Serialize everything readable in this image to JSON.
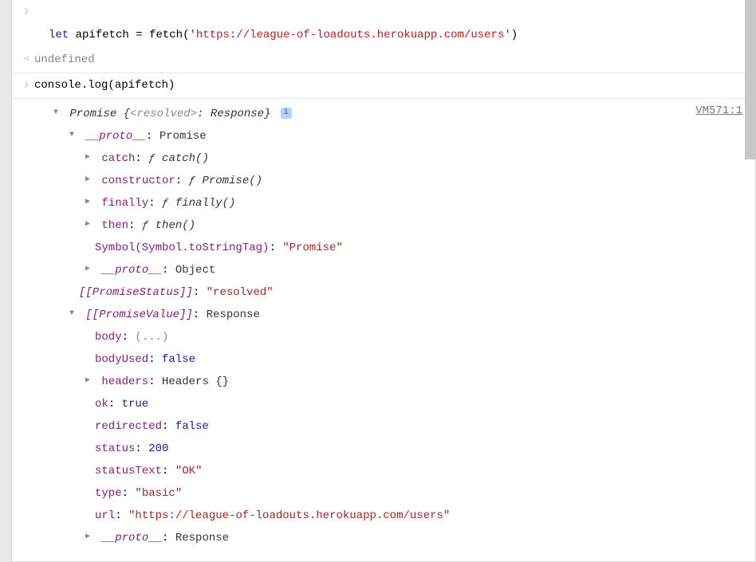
{
  "input1": {
    "indent_fill": "",
    "let": "let",
    "varname": "apifetch",
    "eq": " = ",
    "fn": "fetch(",
    "arg": "'https://league-of-loadouts.herokuapp.com/users'",
    "close": ")"
  },
  "return1": "undefined",
  "input2": "console.log(apifetch)",
  "log": {
    "source": "VM571:1",
    "header_pre": "Promise {",
    "header_status": "<resolved>",
    "header_colon": ": ",
    "header_val": "Response",
    "header_close": "}",
    "proto_label": "__proto__",
    "proto_val": "Promise",
    "catch_label": "catch",
    "catch_val_f": "ƒ ",
    "catch_val": "catch()",
    "constructor_label": "constructor",
    "constructor_val_f": "ƒ ",
    "constructor_val": "Promise()",
    "finally_label": "finally",
    "finally_val_f": "ƒ ",
    "finally_val": "finally()",
    "then_label": "then",
    "then_val_f": "ƒ ",
    "then_val": "then()",
    "symbol_label": "Symbol(Symbol.toStringTag)",
    "symbol_val": "\"Promise\"",
    "proto2_label": "__proto__",
    "proto2_val": "Object",
    "pstatus_label": "[[PromiseStatus]]",
    "pstatus_val": "\"resolved\"",
    "pvalue_label": "[[PromiseValue]]",
    "pvalue_val": "Response",
    "body_label": "body",
    "body_val": "(...)",
    "bodyused_label": "bodyUsed",
    "bodyused_val": "false",
    "headers_label": "headers",
    "headers_val": "Headers {}",
    "ok_label": "ok",
    "ok_val": "true",
    "redirected_label": "redirected",
    "redirected_val": "false",
    "status_label": "status",
    "status_val": "200",
    "statustext_label": "statusText",
    "statustext_val": "\"OK\"",
    "type_label": "type",
    "type_val": "\"basic\"",
    "url_label": "url",
    "url_val": "\"https://league-of-loadouts.herokuapp.com/users\"",
    "proto3_label": "__proto__",
    "proto3_val": "Response"
  }
}
